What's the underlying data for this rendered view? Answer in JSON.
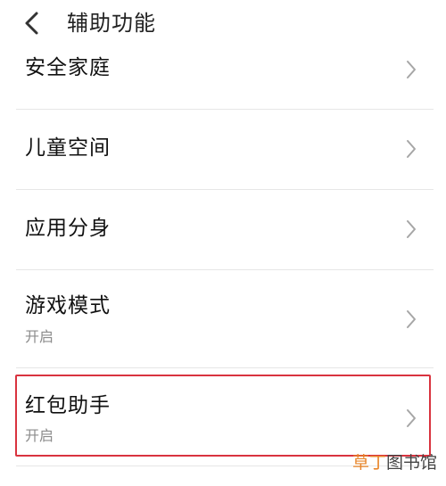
{
  "header": {
    "title": "辅助功能",
    "back_icon": "chevron-left-icon"
  },
  "items": [
    {
      "title": "安全家庭",
      "subtitle": ""
    },
    {
      "title": "儿童空间",
      "subtitle": ""
    },
    {
      "title": "应用分身",
      "subtitle": ""
    },
    {
      "title": "游戏模式",
      "subtitle": "开启"
    },
    {
      "title": "红包助手",
      "subtitle": "开启",
      "highlighted": true
    }
  ],
  "watermark": {
    "part1": "草丁",
    "part2": "图书馆"
  },
  "colors": {
    "highlight_border": "#d9333f",
    "subtitle": "#8c8c8c",
    "divider": "#e6e6e6",
    "chevron": "#a6a6a6",
    "watermark_accent": "#e8852a"
  }
}
